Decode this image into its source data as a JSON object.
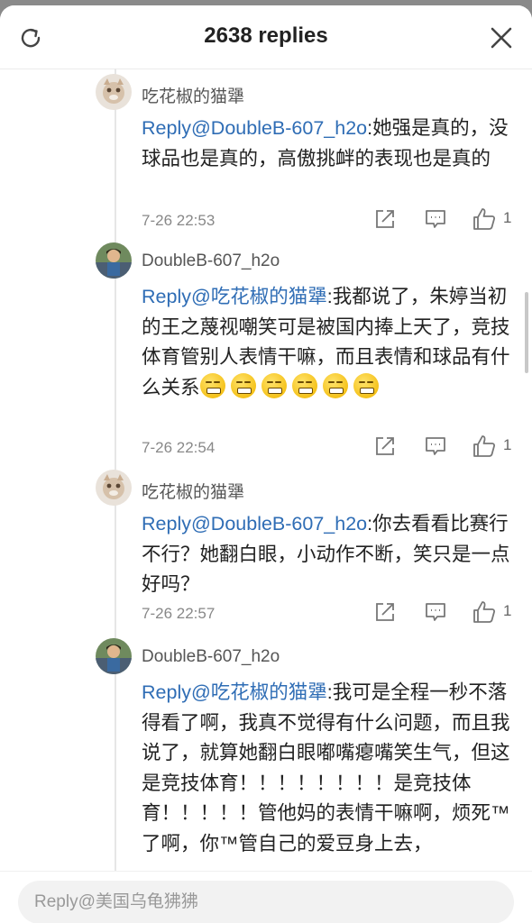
{
  "header": {
    "title": "2638 replies",
    "refresh_icon": "refresh-icon",
    "close_icon": "close-icon"
  },
  "comments": [
    {
      "username": "吃花椒的猫犟",
      "reply_prefix": "Reply",
      "mention": "@DoubleB-607_h2o",
      "text": ":她强是真的，没球品也是真的，高傲挑衅的表现也是真的",
      "time": "7-26 22:53",
      "likes": "1"
    },
    {
      "username": "DoubleB-607_h2o",
      "reply_prefix": "Reply",
      "mention": "@吃花椒的猫犟",
      "text": ":我都说了，朱婷当初的王之蔑视嘲笑可是被国内捧上天了，竞技体育管别人表情干嘛，而且表情和球品有什么关系",
      "emoji_name": "grinning-emoji",
      "time": "7-26 22:54",
      "likes": "1"
    },
    {
      "username": "吃花椒的猫犟",
      "reply_prefix": "Reply",
      "mention": "@DoubleB-607_h2o",
      "text": ":你去看看比赛行不行？她翻白眼，小动作不断，笑只是一点好吗？",
      "time": "7-26 22:57",
      "likes": "1"
    },
    {
      "username": "DoubleB-607_h2o",
      "reply_prefix": "Reply",
      "mention": "@吃花椒的猫犟",
      "text": ":我可是全程一秒不落得看了啊，我真不觉得有什么问题，而且我说了，就算她翻白眼嘟嘴瘪嘴笑生气，但这是竞技体育！！！！！！！！是竞技体育！！！！！管他妈的表情干嘛啊，烦死™了啊，你™管自己的爱豆身上去，"
    }
  ],
  "footer": {
    "reply_placeholder": "Reply@美国乌龟狒狒"
  },
  "colors": {
    "mention": "#2f6db5",
    "meta": "#888888"
  }
}
